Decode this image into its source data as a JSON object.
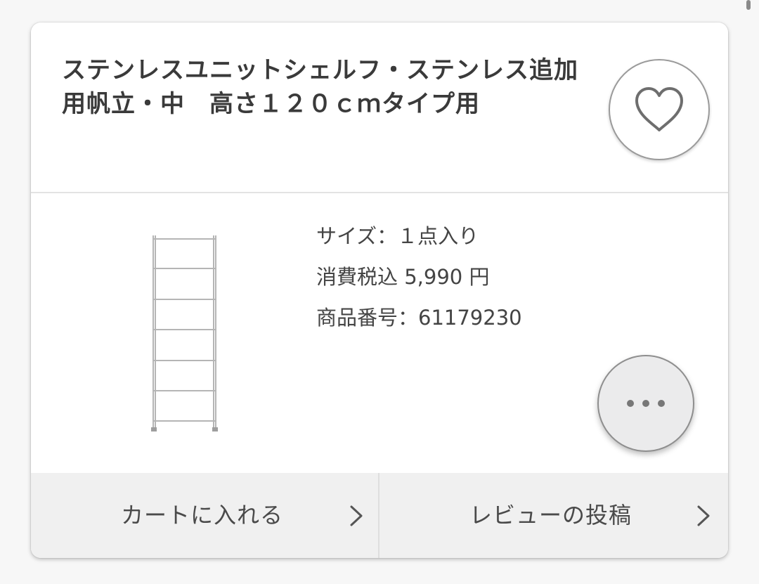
{
  "product": {
    "title": "ステンレスユニットシェルフ・ステンレス追加用帆立・中　高さ１２０ｃｍタイプ用",
    "details": {
      "size": "サイズ：１点入り",
      "price": "消費税込 5,990 円",
      "product_number": "商品番号：61179230"
    }
  },
  "icons": {
    "favorite": "heart-outline-icon",
    "more": "more-dots-icon",
    "chevron": "chevron-right-icon"
  },
  "actions": {
    "cart_label": "カートに入れる",
    "review_label": "レビューの投稿"
  },
  "colors": {
    "card_background": "#ffffff",
    "action_bar_background": "#f0f0f0",
    "more_button_background": "#ebebec",
    "text": "#3a3a3a"
  }
}
